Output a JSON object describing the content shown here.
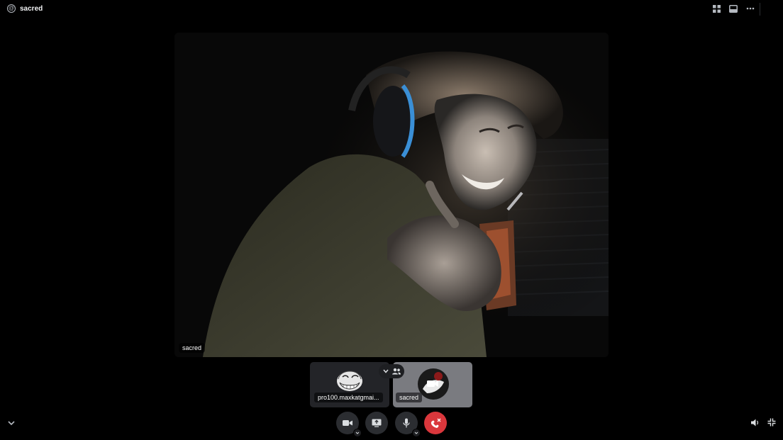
{
  "header": {
    "channel_icon": "at-icon",
    "channel_name": "sacred",
    "actions": [
      "grid-icon",
      "inbox-icon",
      "more-icon"
    ]
  },
  "main_video": {
    "label": "sacred"
  },
  "tiles": [
    {
      "name": "pro100.maxkatgmai...",
      "avatar": "troll-face-avatar",
      "camera": "off"
    },
    {
      "name": "sacred",
      "avatar": "user-avatar",
      "camera": "off"
    }
  ],
  "controls": {
    "camera": "camera-icon",
    "screen_share": "screen-share-icon",
    "microphone": "microphone-icon",
    "leave": "leave-call-icon",
    "volume": "volume-icon",
    "fullscreen": "exit-fullscreen-icon",
    "collapse": "chevron-down-icon"
  },
  "colors": {
    "background": "#000000",
    "control": "#2b2d31",
    "leave": "#da373c",
    "headset_accent": "#3a8fd6"
  }
}
